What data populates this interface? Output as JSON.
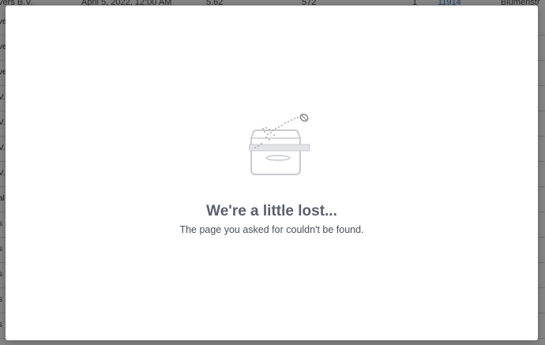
{
  "background": {
    "header_cells": [
      "vers B.V.",
      "April 5, 2022, 12:00 AM",
      "5.62",
      "572",
      "1",
      "11914",
      "Blumenstr"
    ],
    "row_left_fragments": [
      "ve",
      "ve",
      "ve",
      "V.",
      "V.",
      "V.",
      "V.",
      "al",
      "s",
      "s",
      "s",
      "s",
      "s"
    ],
    "row_right_fragments": [
      "",
      "",
      "",
      "",
      "",
      "",
      "",
      "",
      "",
      "",
      "",
      "",
      ""
    ]
  },
  "modal": {
    "title": "We're a little lost...",
    "subtitle": "The page you asked for couldn't be found.",
    "illustration_icon": "empty-box-with-seed-icon"
  },
  "colors": {
    "overlay": "rgba(0,0,0,0.48)",
    "title": "#5a5f6b",
    "subtitle": "#4a4f5a",
    "link": "#3a77c8"
  }
}
